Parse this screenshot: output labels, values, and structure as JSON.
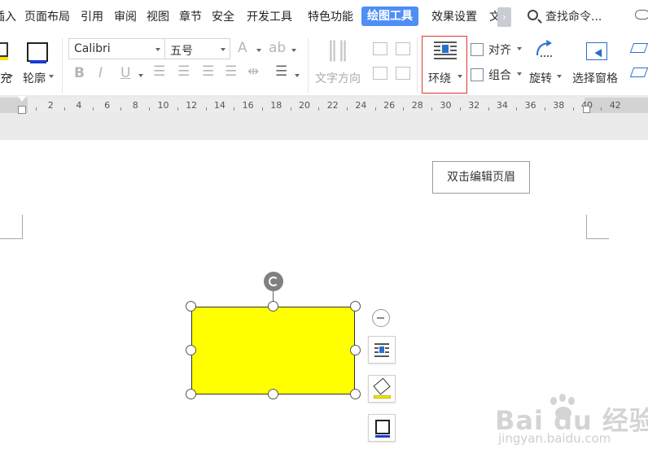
{
  "menu": {
    "items": [
      "插入",
      "页面布局",
      "引用",
      "审阅",
      "视图",
      "章节",
      "安全",
      "开发工具",
      "特色功能",
      "绘图工具",
      "效果设置",
      "文"
    ],
    "active_item": "绘图工具",
    "more": "›",
    "search_label": "查找命令..."
  },
  "ribbon": {
    "fill_label": "填充",
    "outline_label": "轮廓",
    "font_name": "Calibri",
    "font_size": "五号",
    "bold": "B",
    "italic": "I",
    "underline": "U",
    "text_direction_label": "文字方向",
    "wrap_label": "环绕",
    "align_label": "对齐",
    "group_label": "组合",
    "rotate_label": "旋转",
    "selection_pane_label": "选择窗格"
  },
  "ruler": {
    "numbers": [
      "2",
      "4",
      "6",
      "8",
      "10",
      "12",
      "14",
      "16",
      "18",
      "20",
      "22",
      "24",
      "26",
      "28",
      "30",
      "32",
      "34",
      "36",
      "38",
      "40",
      "42"
    ]
  },
  "document": {
    "header_hint": "双击编辑页眉"
  },
  "shape": {
    "fill_color": "#ffff00",
    "outline_color": "#333333"
  },
  "watermark": {
    "brand": "Bai du 经验",
    "url": "jingyan.baidu.com"
  },
  "colors": {
    "active_tab": "#4e8ef7",
    "highlight_border": "#e0352e",
    "fill_yellow": "#f5e400",
    "outline_blue": "#1a3cd1"
  }
}
